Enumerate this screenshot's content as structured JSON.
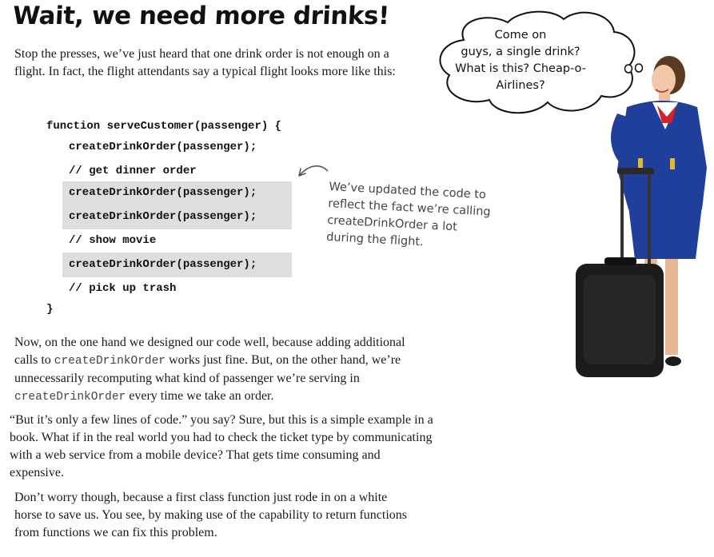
{
  "title": "Wait, we need more drinks!",
  "intro": "Stop the presses, we’ve just heard that one drink order is not enough on a flight. In fact, the flight attendants say a typical flight looks more like this:",
  "code": [
    "function serveCustomer(passenger) {",
    "createDrinkOrder(passenger);",
    "// get dinner order",
    "createDrinkOrder(passenger);",
    "createDrinkOrder(passenger);",
    "// show movie",
    "createDrinkOrder(passenger);",
    "// pick up trash",
    "}"
  ],
  "annotation": [
    "We’ve updated the code to",
    "reflect the fact we’re calling",
    "createDrinkOrder a lot",
    "during the flight."
  ],
  "speech_bubble": [
    "Come on",
    "guys, a single drink?",
    "What is this? Cheap-o-",
    "Airlines?"
  ],
  "para2": {
    "part1": "Now, on the one hand we designed our code well, because adding additional calls to ",
    "code1": "createDrinkOrder",
    "part2": " works just fine. But, on the other hand, we’re unnecessarily recomputing what kind of passenger we’re serving in ",
    "code2": "createDrinkOrder",
    "part3": " every time we take an order."
  },
  "para3": "“But it’s only a few lines of code.” you say? Sure, but this is a simple example in a book. What if in the real world you had to check the ticket type by communicating with a web service from a mobile device? That gets time consuming and expensive.",
  "para4": "Don’t worry though, because a first class function just rode in on a white horse to save us. You see, by making use of the capability to return functions from functions we can fix this problem.",
  "colors": {
    "highlight": "#dedede",
    "uniform": "#1f3f9a",
    "scarf": "#d8202b",
    "suitcase": "#1c1c1c"
  }
}
